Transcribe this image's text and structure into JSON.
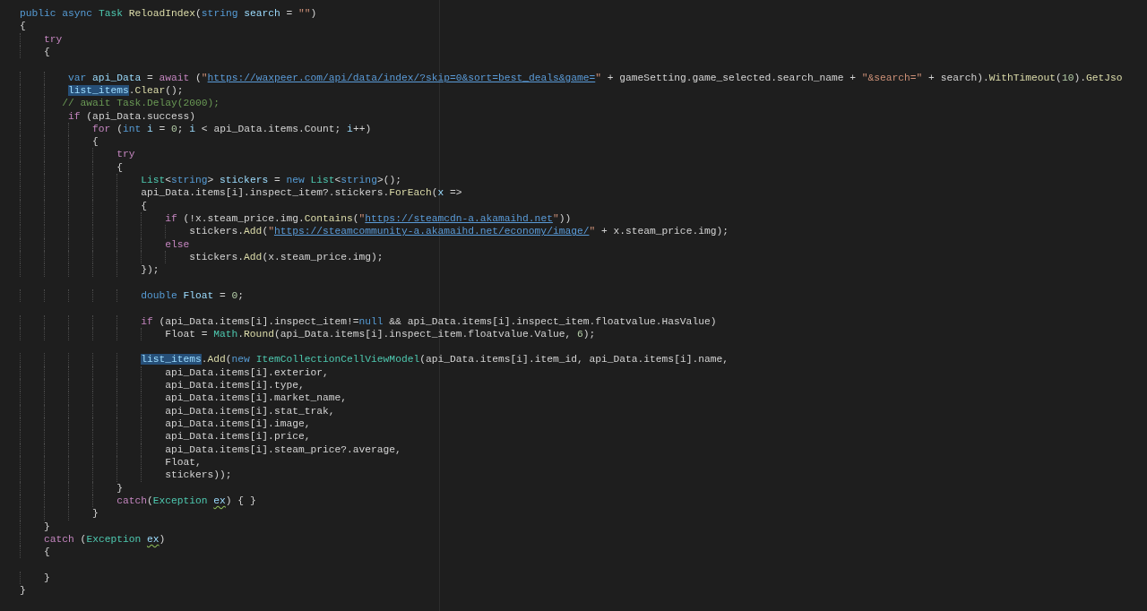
{
  "editor": {
    "lines": [
      {
        "kind": "code",
        "tokens": [
          {
            "kind": "keyword",
            "text": "public "
          },
          {
            "kind": "keyword",
            "text": "async "
          },
          {
            "kind": "type",
            "text": "Task "
          },
          {
            "kind": "function",
            "text": "ReloadIndex"
          },
          {
            "kind": "plain",
            "text": "("
          },
          {
            "kind": "keyword",
            "text": "string "
          },
          {
            "kind": "variable",
            "text": "search"
          },
          {
            "kind": "plain",
            "text": " = "
          },
          {
            "kind": "string",
            "text": "\"\""
          },
          {
            "kind": "plain",
            "text": ")"
          }
        ]
      },
      {
        "kind": "code",
        "tokens": [
          {
            "kind": "plain",
            "text": "{"
          }
        ]
      },
      {
        "kind": "code",
        "tokens": [
          {
            "kind": "control",
            "text": "    try"
          }
        ]
      },
      {
        "kind": "code",
        "tokens": [
          {
            "kind": "plain",
            "text": "    {"
          }
        ]
      },
      {
        "kind": "blank"
      },
      {
        "kind": "code",
        "tokens": [
          {
            "kind": "keyword",
            "text": "        var "
          },
          {
            "kind": "variable",
            "text": "api_Data"
          },
          {
            "kind": "plain",
            "text": " = "
          },
          {
            "kind": "control",
            "text": "await"
          },
          {
            "kind": "plain",
            "text": " ("
          },
          {
            "kind": "string",
            "text": "\""
          },
          {
            "kind": "link",
            "text": "https://waxpeer.com/api/data/index/?skip=0&sort=best_deals&game="
          },
          {
            "kind": "string",
            "text": "\""
          },
          {
            "kind": "plain",
            "text": " + gameSetting.game_selected.search_name + "
          },
          {
            "kind": "string",
            "text": "\"&search=\""
          },
          {
            "kind": "plain",
            "text": " + search)."
          },
          {
            "kind": "function",
            "text": "WithTimeout"
          },
          {
            "kind": "plain",
            "text": "("
          },
          {
            "kind": "number",
            "text": "10"
          },
          {
            "kind": "plain",
            "text": ")."
          },
          {
            "kind": "function",
            "text": "GetJso"
          }
        ]
      },
      {
        "kind": "code",
        "tokens": [
          {
            "kind": "selection",
            "text": "        list_items"
          },
          {
            "kind": "plain",
            "text": "."
          },
          {
            "kind": "function",
            "text": "Clear"
          },
          {
            "kind": "plain",
            "text": "();"
          }
        ]
      },
      {
        "kind": "code",
        "tokens": [
          {
            "kind": "comment",
            "text": "       // await Task.Delay(2000);"
          }
        ]
      },
      {
        "kind": "code",
        "tokens": [
          {
            "kind": "control",
            "text": "        if"
          },
          {
            "kind": "plain",
            "text": " (api_Data.success)"
          }
        ]
      },
      {
        "kind": "code",
        "tokens": [
          {
            "kind": "control",
            "text": "            for"
          },
          {
            "kind": "plain",
            "text": " ("
          },
          {
            "kind": "keyword",
            "text": "int "
          },
          {
            "kind": "variable",
            "text": "i"
          },
          {
            "kind": "plain",
            "text": " = "
          },
          {
            "kind": "number",
            "text": "0"
          },
          {
            "kind": "plain",
            "text": "; "
          },
          {
            "kind": "variable",
            "text": "i"
          },
          {
            "kind": "plain",
            "text": " < api_Data.items.Count; "
          },
          {
            "kind": "variable",
            "text": "i"
          },
          {
            "kind": "plain",
            "text": "++)"
          }
        ]
      },
      {
        "kind": "code",
        "tokens": [
          {
            "kind": "plain",
            "text": "            {"
          }
        ]
      },
      {
        "kind": "code",
        "tokens": [
          {
            "kind": "control",
            "text": "                try"
          }
        ]
      },
      {
        "kind": "code",
        "tokens": [
          {
            "kind": "plain",
            "text": "                {"
          }
        ]
      },
      {
        "kind": "code",
        "tokens": [
          {
            "kind": "type",
            "text": "                    List"
          },
          {
            "kind": "plain",
            "text": "<"
          },
          {
            "kind": "keyword",
            "text": "string"
          },
          {
            "kind": "plain",
            "text": "> "
          },
          {
            "kind": "variable",
            "text": "stickers"
          },
          {
            "kind": "plain",
            "text": " = "
          },
          {
            "kind": "keyword",
            "text": "new "
          },
          {
            "kind": "type",
            "text": "List"
          },
          {
            "kind": "plain",
            "text": "<"
          },
          {
            "kind": "keyword",
            "text": "string"
          },
          {
            "kind": "plain",
            "text": ">();"
          }
        ]
      },
      {
        "kind": "code",
        "tokens": [
          {
            "kind": "plain",
            "text": "                    api_Data.items[i].inspect_item?.stickers."
          },
          {
            "kind": "function",
            "text": "ForEach"
          },
          {
            "kind": "plain",
            "text": "("
          },
          {
            "kind": "variable",
            "text": "x"
          },
          {
            "kind": "plain",
            "text": " =>"
          }
        ]
      },
      {
        "kind": "code",
        "tokens": [
          {
            "kind": "plain",
            "text": "                    {"
          }
        ]
      },
      {
        "kind": "code",
        "tokens": [
          {
            "kind": "control",
            "text": "                        if"
          },
          {
            "kind": "plain",
            "text": " (!x.steam_price.img."
          },
          {
            "kind": "function",
            "text": "Contains"
          },
          {
            "kind": "plain",
            "text": "("
          },
          {
            "kind": "string",
            "text": "\""
          },
          {
            "kind": "link",
            "text": "https://steamcdn-a.akamaihd.net"
          },
          {
            "kind": "string",
            "text": "\""
          },
          {
            "kind": "plain",
            "text": "))"
          }
        ]
      },
      {
        "kind": "code",
        "tokens": [
          {
            "kind": "plain",
            "text": "                            stickers."
          },
          {
            "kind": "function",
            "text": "Add"
          },
          {
            "kind": "plain",
            "text": "("
          },
          {
            "kind": "string",
            "text": "\""
          },
          {
            "kind": "link",
            "text": "https://steamcommunity-a.akamaihd.net/economy/image/"
          },
          {
            "kind": "string",
            "text": "\""
          },
          {
            "kind": "plain",
            "text": " + x.steam_price.img);"
          }
        ]
      },
      {
        "kind": "code",
        "tokens": [
          {
            "kind": "control",
            "text": "                        else"
          }
        ]
      },
      {
        "kind": "code",
        "tokens": [
          {
            "kind": "plain",
            "text": "                            stickers."
          },
          {
            "kind": "function",
            "text": "Add"
          },
          {
            "kind": "plain",
            "text": "(x.steam_price.img);"
          }
        ]
      },
      {
        "kind": "code",
        "tokens": [
          {
            "kind": "plain",
            "text": "                    });"
          }
        ]
      },
      {
        "kind": "blank"
      },
      {
        "kind": "code",
        "tokens": [
          {
            "kind": "keyword",
            "text": "                    double "
          },
          {
            "kind": "variable",
            "text": "Float"
          },
          {
            "kind": "plain",
            "text": " = "
          },
          {
            "kind": "number",
            "text": "0"
          },
          {
            "kind": "plain",
            "text": ";"
          }
        ]
      },
      {
        "kind": "blank"
      },
      {
        "kind": "code",
        "tokens": [
          {
            "kind": "control",
            "text": "                    if"
          },
          {
            "kind": "plain",
            "text": " (api_Data.items[i].inspect_item!="
          },
          {
            "kind": "keyword",
            "text": "null"
          },
          {
            "kind": "plain",
            "text": " && api_Data.items[i].inspect_item.floatvalue.HasValue)"
          }
        ]
      },
      {
        "kind": "code",
        "tokens": [
          {
            "kind": "plain",
            "text": "                        Float = "
          },
          {
            "kind": "type",
            "text": "Math"
          },
          {
            "kind": "plain",
            "text": "."
          },
          {
            "kind": "function",
            "text": "Round"
          },
          {
            "kind": "plain",
            "text": "(api_Data.items[i].inspect_item.floatvalue.Value, "
          },
          {
            "kind": "number",
            "text": "6"
          },
          {
            "kind": "plain",
            "text": ");"
          }
        ]
      },
      {
        "kind": "blank"
      },
      {
        "kind": "code",
        "tokens": [
          {
            "kind": "selection",
            "text": "                    list_items"
          },
          {
            "kind": "plain",
            "text": "."
          },
          {
            "kind": "function",
            "text": "Add"
          },
          {
            "kind": "plain",
            "text": "("
          },
          {
            "kind": "keyword",
            "text": "new "
          },
          {
            "kind": "type",
            "text": "ItemCollectionCellViewModel"
          },
          {
            "kind": "plain",
            "text": "(api_Data.items[i].item_id, api_Data.items[i].name,"
          }
        ]
      },
      {
        "kind": "code",
        "tokens": [
          {
            "kind": "plain",
            "text": "                        api_Data.items[i].exterior,"
          }
        ]
      },
      {
        "kind": "code",
        "tokens": [
          {
            "kind": "plain",
            "text": "                        api_Data.items[i].type,"
          }
        ]
      },
      {
        "kind": "code",
        "tokens": [
          {
            "kind": "plain",
            "text": "                        api_Data.items[i].market_name,"
          }
        ]
      },
      {
        "kind": "code",
        "tokens": [
          {
            "kind": "plain",
            "text": "                        api_Data.items[i].stat_trak,"
          }
        ]
      },
      {
        "kind": "code",
        "tokens": [
          {
            "kind": "plain",
            "text": "                        api_Data.items[i].image,"
          }
        ]
      },
      {
        "kind": "code",
        "tokens": [
          {
            "kind": "plain",
            "text": "                        api_Data.items[i].price,"
          }
        ]
      },
      {
        "kind": "code",
        "tokens": [
          {
            "kind": "plain",
            "text": "                        api_Data.items[i].steam_price?.average,"
          }
        ]
      },
      {
        "kind": "code",
        "tokens": [
          {
            "kind": "plain",
            "text": "                        Float,"
          }
        ]
      },
      {
        "kind": "code",
        "tokens": [
          {
            "kind": "plain",
            "text": "                        stickers));"
          }
        ]
      },
      {
        "kind": "code",
        "tokens": [
          {
            "kind": "plain",
            "text": "                }"
          }
        ]
      },
      {
        "kind": "code",
        "tokens": [
          {
            "kind": "control",
            "text": "                catch"
          },
          {
            "kind": "plain",
            "text": "("
          },
          {
            "kind": "type",
            "text": "Exception "
          },
          {
            "kind": "squiggle",
            "text": "ex"
          },
          {
            "kind": "plain",
            "text": ") { }"
          }
        ]
      },
      {
        "kind": "code",
        "tokens": [
          {
            "kind": "plain",
            "text": "            }"
          }
        ]
      },
      {
        "kind": "code",
        "tokens": [
          {
            "kind": "plain",
            "text": "    }"
          }
        ]
      },
      {
        "kind": "code",
        "tokens": [
          {
            "kind": "control",
            "text": "    catch"
          },
          {
            "kind": "plain",
            "text": " ("
          },
          {
            "kind": "type",
            "text": "Exception "
          },
          {
            "kind": "squiggle",
            "text": "ex"
          },
          {
            "kind": "plain",
            "text": ")"
          }
        ]
      },
      {
        "kind": "code",
        "tokens": [
          {
            "kind": "plain",
            "text": "    {"
          }
        ]
      },
      {
        "kind": "blank"
      },
      {
        "kind": "code",
        "tokens": [
          {
            "kind": "plain",
            "text": "    }"
          }
        ]
      },
      {
        "kind": "code",
        "tokens": [
          {
            "kind": "plain",
            "text": "}"
          }
        ]
      }
    ]
  }
}
